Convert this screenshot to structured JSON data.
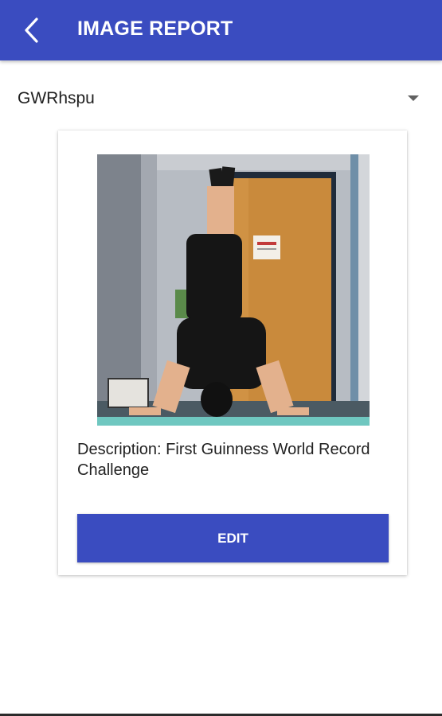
{
  "header": {
    "title": "IMAGE REPORT",
    "back_icon": "back-chevron-icon"
  },
  "dropdown": {
    "selected": "GWRhspu",
    "arrow_icon": "dropdown-arrow-icon"
  },
  "card": {
    "image_alt": "person doing a headstand in front of a door",
    "description": "Description: First Guinness World Record Challenge",
    "edit_label": "EDIT"
  },
  "colors": {
    "primary": "#3a4cc0",
    "text": "#222222",
    "background": "#ffffff"
  }
}
